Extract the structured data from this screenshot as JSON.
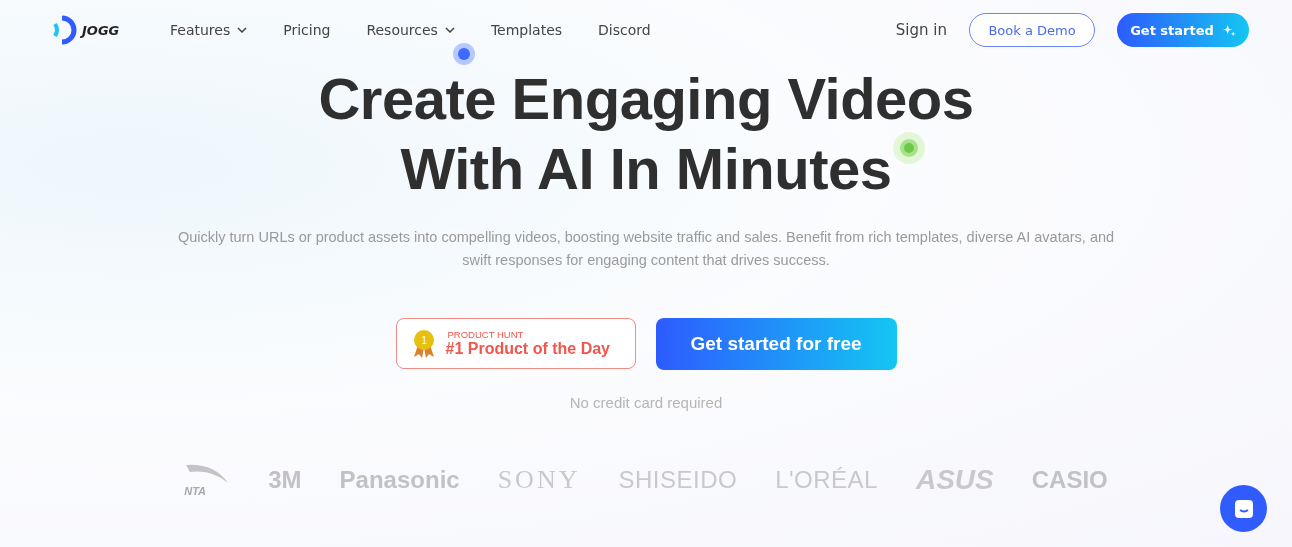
{
  "header": {
    "brand": "JOGG",
    "nav": [
      {
        "label": "Features",
        "dropdown": true
      },
      {
        "label": "Pricing",
        "dropdown": false
      },
      {
        "label": "Resources",
        "dropdown": true
      },
      {
        "label": "Templates",
        "dropdown": false
      },
      {
        "label": "Discord",
        "dropdown": false
      }
    ],
    "sign_in": "Sign in",
    "demo_button": "Book a Demo",
    "start_button": "Get started"
  },
  "hero": {
    "title_lines": [
      "Create Engaging Videos",
      "With AI In Minutes"
    ],
    "subtitle": "Quickly turn URLs or product assets into compelling videos, boosting website traffic and sales. Benefit from rich templates, diverse AI avatars, and swift responses for engaging content that drives success.",
    "badge": {
      "eyebrow": "PRODUCT HUNT",
      "label": "#1 Product of the Day",
      "medal": "1"
    },
    "cta": "Get started for free",
    "note": "No credit card required"
  },
  "logos": [
    {
      "name": "NTA",
      "kind": "swoosh"
    },
    {
      "name": "3M",
      "kind": "heavy"
    },
    {
      "name": "Panasonic",
      "kind": "heavy"
    },
    {
      "name": "SONY",
      "kind": "serif"
    },
    {
      "name": "SHISEIDO",
      "kind": "thin"
    },
    {
      "name": "L'ORÉAL",
      "kind": "thin"
    },
    {
      "name": "ASUS",
      "kind": "italic"
    },
    {
      "name": "CASIO",
      "kind": "heavy"
    }
  ]
}
